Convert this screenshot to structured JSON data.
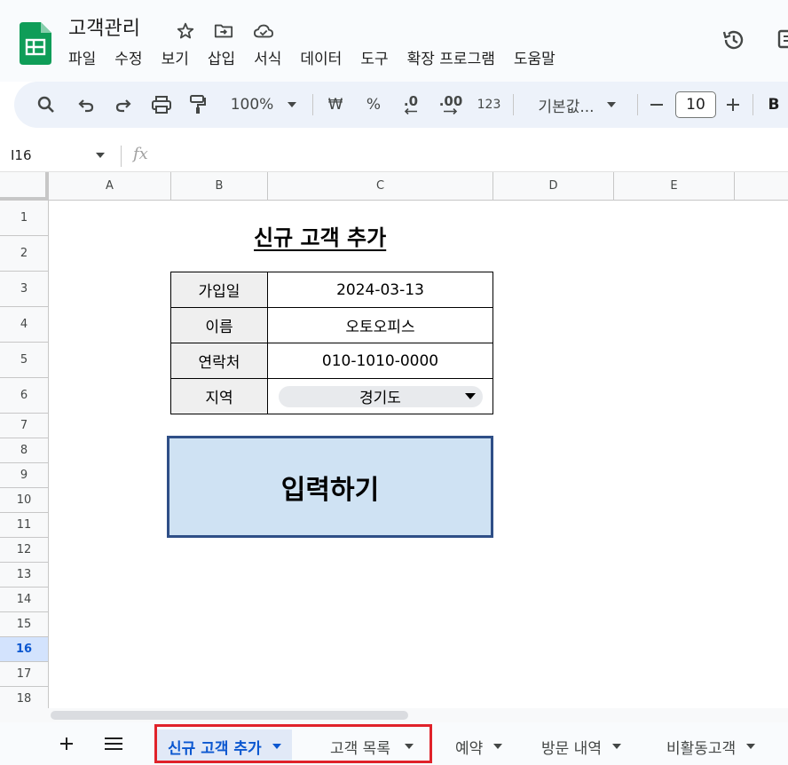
{
  "app": {
    "title": "고객관리",
    "menu": [
      "파일",
      "수정",
      "보기",
      "삽입",
      "서식",
      "데이터",
      "도구",
      "확장 프로그램",
      "도움말"
    ]
  },
  "toolbar": {
    "zoom": "100%",
    "currency": "₩",
    "percent": "%",
    "decrease_decimal": ".0",
    "increase_decimal": ".00",
    "number_format": "123",
    "font": "기본값...",
    "font_size": "10",
    "bold": "B"
  },
  "formula_bar": {
    "cell_ref": "I16",
    "fx": "fx"
  },
  "grid": {
    "columns": [
      "A",
      "B",
      "C",
      "D",
      "E"
    ],
    "rows": [
      "1",
      "2",
      "3",
      "4",
      "5",
      "6",
      "7",
      "8",
      "9",
      "10",
      "11",
      "12",
      "13",
      "14",
      "15",
      "16",
      "17",
      "18"
    ],
    "active_row": "16"
  },
  "form": {
    "title": "신규 고객 추가",
    "fields": [
      {
        "label": "가입일",
        "value": "2024-03-13"
      },
      {
        "label": "이름",
        "value": "오토오피스"
      },
      {
        "label": "연락처",
        "value": "010-1010-0000"
      },
      {
        "label": "지역",
        "value": "경기도"
      }
    ],
    "submit_label": "입력하기"
  },
  "sheet_tabs": [
    {
      "label": "신규 고객 추가",
      "active": true
    },
    {
      "label": "고객 목록",
      "active": false
    },
    {
      "label": "예약",
      "active": false
    },
    {
      "label": "방문 내역",
      "active": false
    },
    {
      "label": "비활동고객",
      "active": false
    }
  ],
  "icons": {
    "header": [
      "star-icon",
      "move-to-folder-icon",
      "cloud-saved-icon",
      "version-history-icon"
    ],
    "toolbar": [
      "search-icon",
      "undo-icon",
      "redo-icon",
      "print-icon",
      "paint-format-icon"
    ]
  },
  "colors": {
    "brand_green": "#0f9d58",
    "active_blue": "#0b57d0",
    "button_fill": "#cfe2f3",
    "button_border": "#2f4f87",
    "highlight_red": "#e0222a"
  }
}
